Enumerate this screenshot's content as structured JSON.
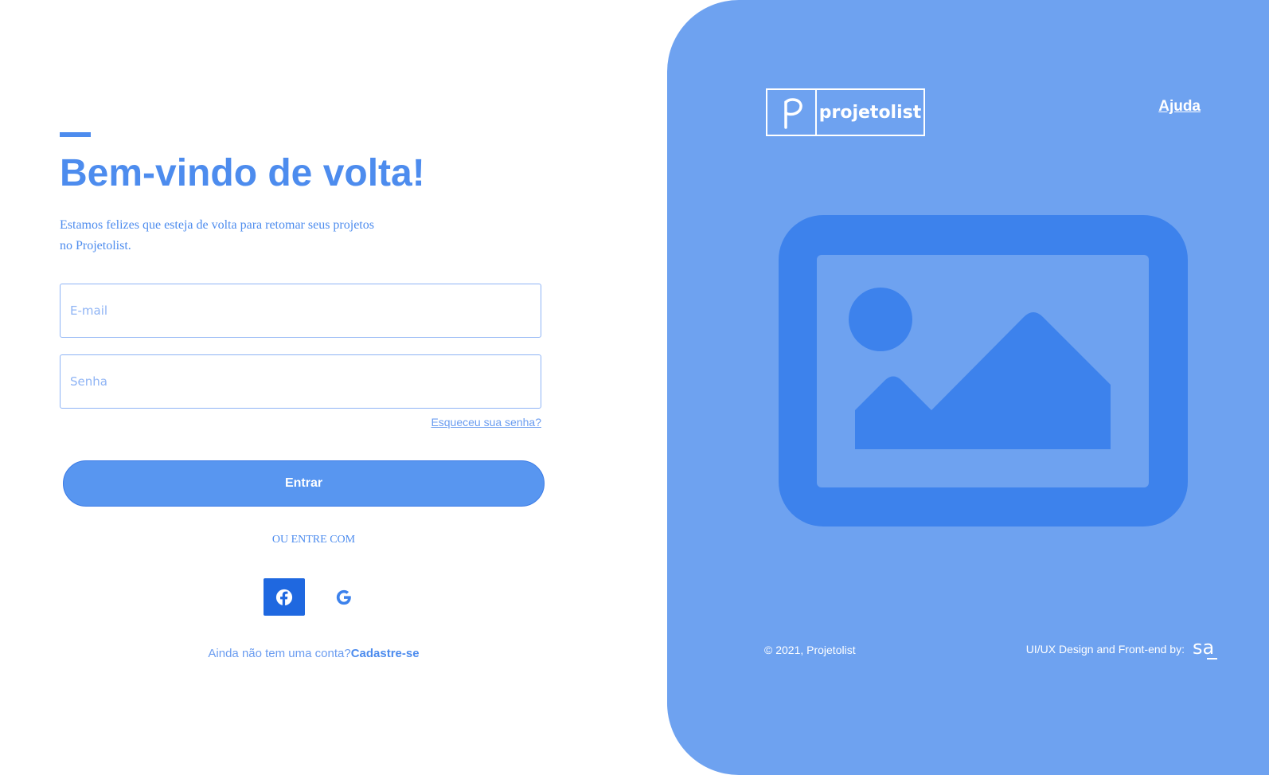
{
  "login": {
    "title": "Bem-vindo de volta!",
    "subtitle": "Estamos felizes que esteja de volta para retomar seus projetos no Projetolist.",
    "email_placeholder": "E-mail",
    "password_placeholder": "Senha",
    "forgot_password": "Esqueceu sua senha?",
    "submit_label": "Entrar",
    "alt_login_label": "OU ENTRE COM",
    "social": [
      "facebook-icon",
      "google-icon"
    ],
    "signup_prompt": "Ainda não tem uma conta?",
    "signup_link": "Cadastre-se"
  },
  "brand": {
    "logo_text": "projetolist",
    "logo_mark": "P"
  },
  "header": {
    "help_link": "Ajuda"
  },
  "footer": {
    "copyright": "© 2021, Projetolist",
    "credit": "UI/UX Design and Front-end by:",
    "credit_logo": "sa"
  },
  "colors": {
    "accent": "#4d8cee",
    "button": "#5896f0",
    "panel": "#6ea2f0",
    "illustration": "#3d82ec",
    "facebook": "#1f68e0"
  }
}
